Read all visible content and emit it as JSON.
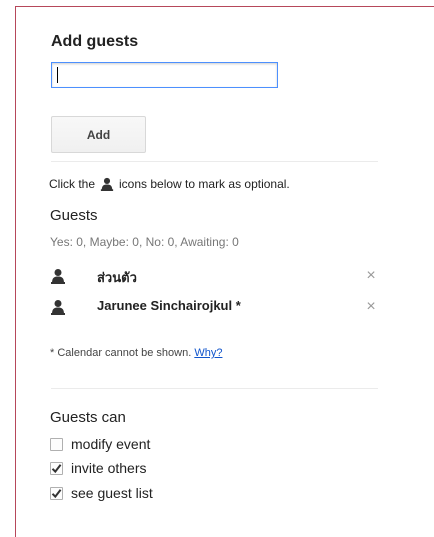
{
  "add_guests": {
    "title": "Add guests",
    "input_value": "",
    "add_button_label": "Add"
  },
  "hint": {
    "before": "Click the",
    "after": "icons below to mark as optional.",
    "icon": "person-icon"
  },
  "guests": {
    "heading": "Guests",
    "counts": "Yes: 0, Maybe: 0, No: 0, Awaiting: 0",
    "list": [
      {
        "name": "ส่วนตัว",
        "remove": "×"
      },
      {
        "name": "Jarunee Sinchairojkul *",
        "remove": "×"
      }
    ]
  },
  "calendar_note": {
    "text": "* Calendar cannot be shown.",
    "link": "Why?"
  },
  "guests_can": {
    "heading": "Guests can",
    "options": [
      {
        "label": "modify event",
        "checked": false
      },
      {
        "label": "invite others",
        "checked": true
      },
      {
        "label": "see guest list",
        "checked": true
      }
    ]
  },
  "colors": {
    "frame": "#b6475a",
    "link": "#1155cc",
    "input_focus": "#4d90fe"
  }
}
